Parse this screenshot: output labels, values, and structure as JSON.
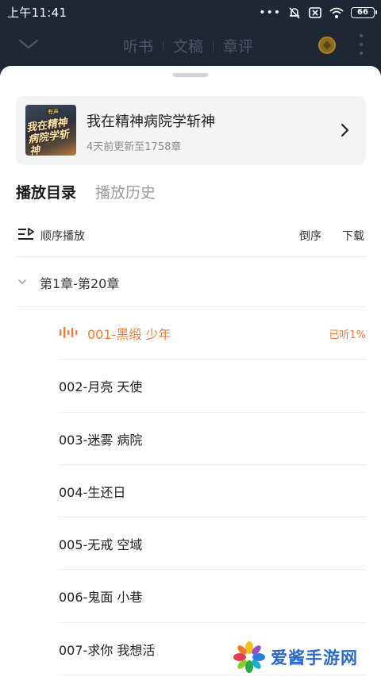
{
  "status_bar": {
    "time": "上午11:41",
    "battery": "66",
    "dots": "•••"
  },
  "header": {
    "tabs": [
      "听书",
      "文稿",
      "章评"
    ],
    "back_icon": "chevron-down-icon",
    "coin_icon": "coin-icon",
    "more_icon": "more-vertical-icon"
  },
  "book": {
    "title": "我在精神病院学斩神",
    "update_info": "4天前更新至1758章",
    "cover_text": "我在精神病院学斩神",
    "cover_badge": "有声"
  },
  "tabs": {
    "catalog": "播放目录",
    "history": "播放历史"
  },
  "controls": {
    "play_order": "顺序播放",
    "reverse": "倒序",
    "download": "下载"
  },
  "group": {
    "label": "第1章-第20章"
  },
  "chapters": [
    {
      "title": "001-黑缎 少年",
      "progress": "已听1%",
      "playing": true
    },
    {
      "title": "002-月亮 天使"
    },
    {
      "title": "003-迷雾 病院"
    },
    {
      "title": "004-生还日"
    },
    {
      "title": "005-无戒 空域"
    },
    {
      "title": "006-鬼面 小巷"
    },
    {
      "title": "007-求你 我想活"
    }
  ],
  "watermark": {
    "text": "爱酱手游网"
  },
  "colors": {
    "accent": "#ef7b3a",
    "header_bg": "#1f2733",
    "watermark": "#2a68c8"
  }
}
